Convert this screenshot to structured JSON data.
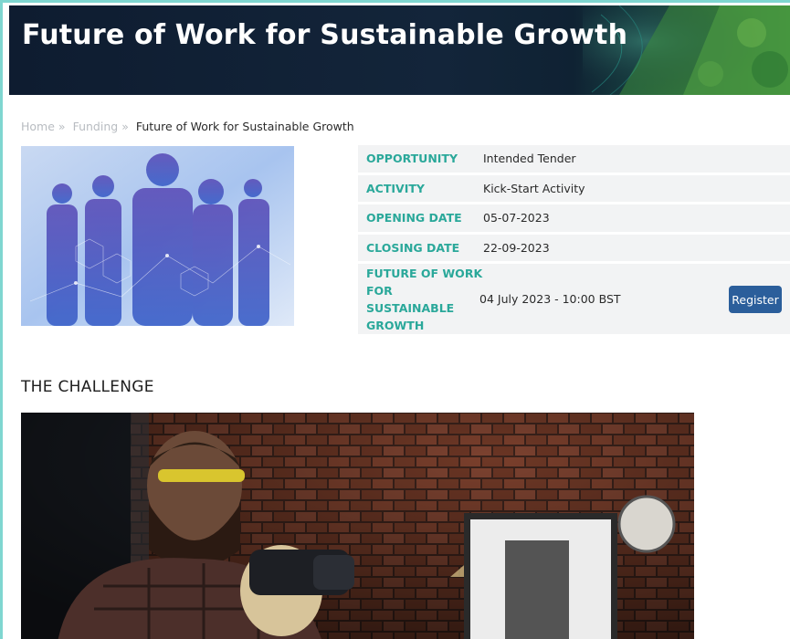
{
  "banner": {
    "title": "Future of Work for Sustainable Growth"
  },
  "breadcrumb": {
    "items": [
      "Home",
      "Funding"
    ],
    "separator": "»",
    "current": "Future of Work for Sustainable Growth"
  },
  "info": {
    "rows": [
      {
        "key": "OPPORTUNITY",
        "value": "Intended Tender"
      },
      {
        "key": "ACTIVITY",
        "value": "Kick-Start Activity"
      },
      {
        "key": "OPENING DATE",
        "value": "05-07-2023"
      },
      {
        "key": "CLOSING DATE",
        "value": "22-09-2023"
      }
    ],
    "event": {
      "key_lines": [
        "FUTURE OF WORK",
        "FOR SUSTAINABLE",
        "GROWTH"
      ],
      "value": "04 July 2023 - 10:00 BST",
      "button_label": "Register"
    }
  },
  "section": {
    "heading": "THE CHALLENGE"
  },
  "colors": {
    "accent": "#2aa89a",
    "button": "#2b5e9b",
    "banner": "#0e1c30",
    "frame": "#7fd6d0"
  }
}
